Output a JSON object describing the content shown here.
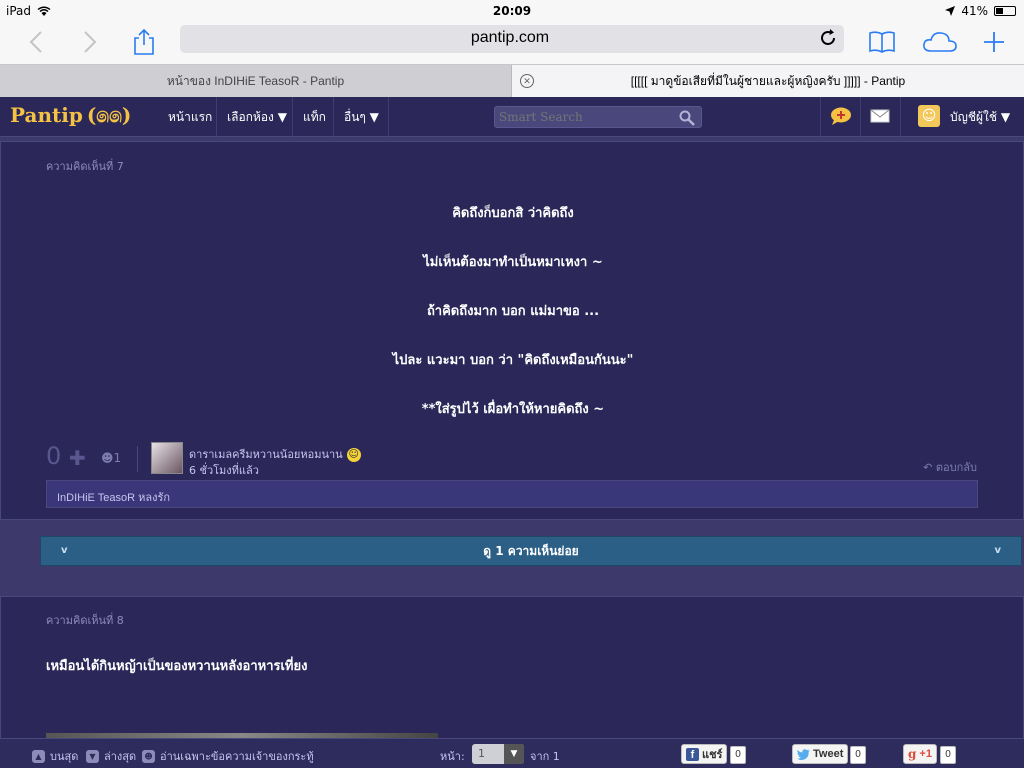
{
  "status_bar": {
    "device": "iPad",
    "time": "20:09",
    "battery": "41%",
    "battery_level": 0.41
  },
  "toolbar": {
    "url": "pantip.com"
  },
  "tabs": [
    {
      "title": "หน้าของ InDIHiE TeasoR - Pantip",
      "active": false
    },
    {
      "title": "[[[[[ มาดูข้อเสียที่มีในผู้ชายและผู้หญิงครับ ]]]]] - Pantip",
      "active": true
    }
  ],
  "nav": {
    "logo": "Pantip",
    "logo_mark": "(෧෧)",
    "items": [
      "หน้าแรก",
      "เลือกห้อง ▼",
      "แท็ก",
      "อื่นๆ ▼"
    ],
    "search_placeholder": "Smart Search",
    "account": "บัญชีผู้ใช้ ▼"
  },
  "comment7": {
    "number": "ความคิดเห็นที่ 7",
    "lines": [
      "คิดถึงก็บอกสิ ว่าคิดถึง",
      "ไม่เห็นต้องมาทำเป็นหมาเหงา ~",
      "ถ้าคิดถึงมาก บอก แม่มาขอ ...",
      "ไปละ แวะมา บอก ว่า \"คิดถึงเหมือนกันนะ\"",
      "**ใส่รูปไว้ เผื่อทำให้หายคิดถึง ~"
    ],
    "votes": "0",
    "emotion_count": "1",
    "author": "ดาราเมลครีมหวานน้อยหอมนาน",
    "time": "6 ชั่วโมงที่แล้ว",
    "reply": "ตอบกลับ",
    "tag": "InDIHiE TeasoR หลงรัก"
  },
  "sub_comments": {
    "label": "ดู 1 ความเห็นย่อย",
    "chevron": "v"
  },
  "comment8": {
    "number": "ความคิดเห็นที่ 8",
    "text": "เหมือนได้กินหญ้าเป็นของหวานหลังอาหารเที่ยง"
  },
  "bottom_bar": {
    "top": "บนสุด",
    "bottom": "ล่างสุด",
    "owner_only": "อ่านเฉพาะข้อความเจ้าของกระทู้",
    "page_label": "หน้า:",
    "page_value": "1",
    "of_label": "จาก 1",
    "fb_label": "แชร์",
    "fb_count": "0",
    "tw_label": "Tweet",
    "tw_count": "0",
    "gp_label": "+1",
    "gp_count": "0"
  }
}
